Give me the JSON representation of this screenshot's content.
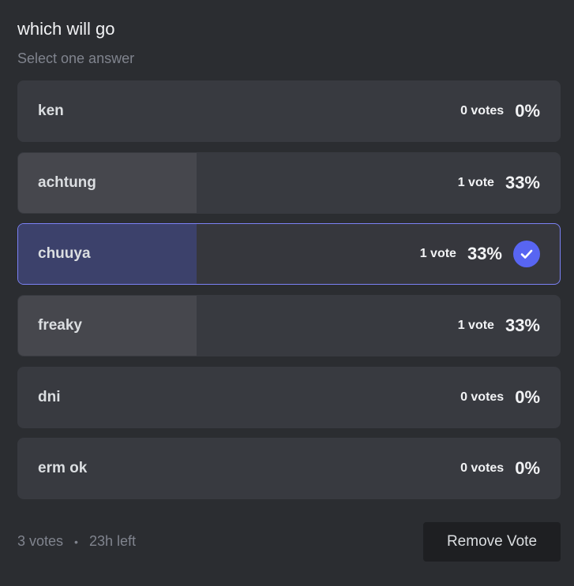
{
  "poll": {
    "question": "which will go",
    "hint": "Select one answer",
    "answers": [
      {
        "label": "ken",
        "votes": "0 votes",
        "percent": "0%",
        "fill": 0,
        "selected": false
      },
      {
        "label": "achtung",
        "votes": "1 vote",
        "percent": "33%",
        "fill": 0.33,
        "selected": false
      },
      {
        "label": "chuuya",
        "votes": "1 vote",
        "percent": "33%",
        "fill": 0.33,
        "selected": true
      },
      {
        "label": "freaky",
        "votes": "1 vote",
        "percent": "33%",
        "fill": 0.33,
        "selected": false
      },
      {
        "label": "dni",
        "votes": "0 votes",
        "percent": "0%",
        "fill": 0,
        "selected": false
      },
      {
        "label": "erm ok",
        "votes": "0 votes",
        "percent": "0%",
        "fill": 0,
        "selected": false
      }
    ],
    "footer": {
      "total_votes": "3 votes",
      "separator": "•",
      "time_left": "23h left",
      "remove_vote_label": "Remove Vote"
    },
    "colors": {
      "accent": "#5865f2",
      "selected_border": "#7b81f5",
      "background": "#2b2d31"
    },
    "icons": {
      "selected_check": "check-icon"
    }
  }
}
